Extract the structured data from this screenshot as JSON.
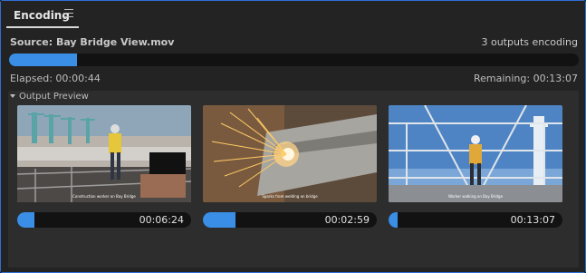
{
  "panel": {
    "tab_label": "Encoding",
    "menu_icon": "hamburger-menu-icon"
  },
  "source": {
    "label": "Source: Bay Bridge View.mov",
    "outputs_text": "3 outputs encoding"
  },
  "overall": {
    "progress": 0.12,
    "elapsed": "Elapsed: 00:00:44",
    "remaining": "Remaining: 00:13:07"
  },
  "preview": {
    "header": "Output Preview",
    "items": [
      {
        "time": "00:06:24",
        "progress": 0.1,
        "caption": "Construction worker on Bay Bridge"
      },
      {
        "time": "00:02:59",
        "progress": 0.19,
        "caption": "Sparks from welding on bridge"
      },
      {
        "time": "00:13:07",
        "progress": 0.05,
        "caption": "Worker walking on Bay Bridge"
      }
    ]
  },
  "colors": {
    "accent": "#3a8ee6",
    "panel_border": "#2f6fd6",
    "background": "#232323"
  }
}
